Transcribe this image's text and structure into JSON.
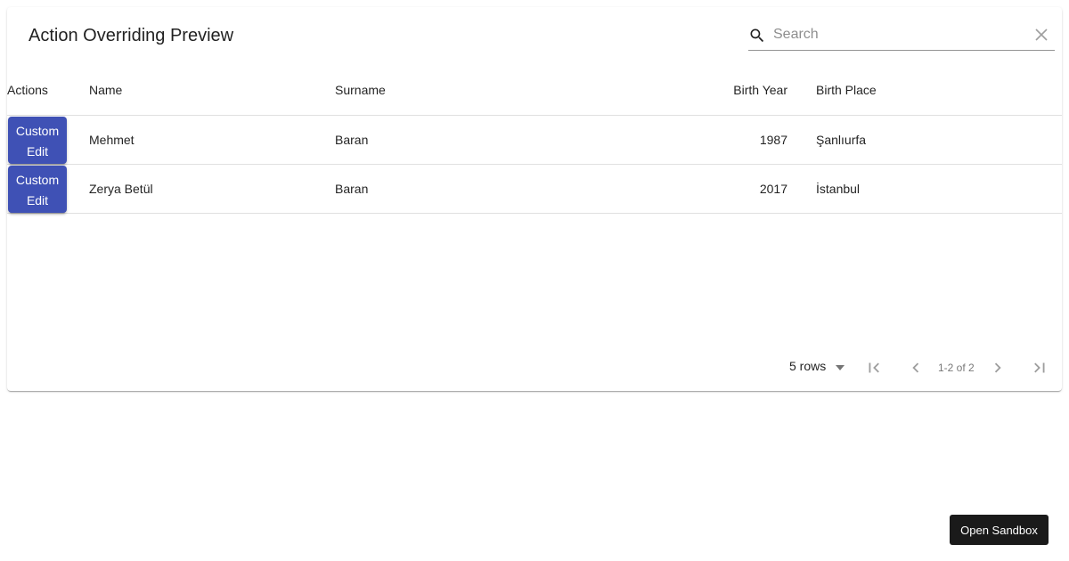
{
  "toolbar": {
    "title": "Action Overriding Preview",
    "search_placeholder": "Search",
    "search_value": ""
  },
  "table": {
    "columns": [
      "Actions",
      "Name",
      "Surname",
      "Birth Year",
      "Birth Place"
    ],
    "action_label": "Custom Edit",
    "rows": [
      {
        "name": "Mehmet",
        "surname": "Baran",
        "birth_year": "1987",
        "birth_place": "Şanlıurfa"
      },
      {
        "name": "Zerya Betül",
        "surname": "Baran",
        "birth_year": "2017",
        "birth_place": "İstanbul"
      }
    ]
  },
  "pagination": {
    "rows_per_page": "5 rows",
    "range": "1-2 of 2"
  },
  "sandbox": {
    "label": "Open Sandbox"
  },
  "colors": {
    "primary": "#3f51b5",
    "sandbox_bg": "#1a1a1a"
  },
  "icons": [
    "search-icon",
    "clear-icon",
    "dropdown-icon",
    "first-page-icon",
    "previous-page-icon",
    "next-page-icon",
    "last-page-icon"
  ]
}
